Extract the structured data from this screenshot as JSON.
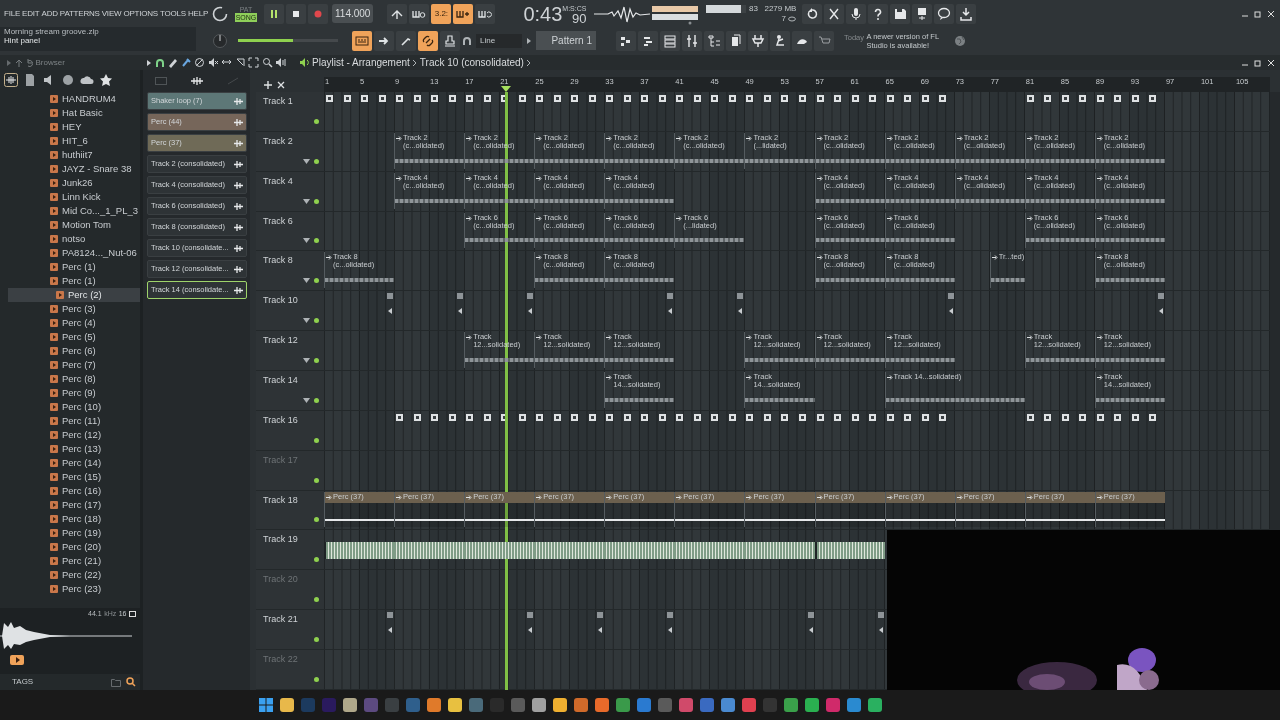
{
  "menu": [
    "FILE",
    "EDIT",
    "ADD",
    "PATTERNS",
    "VIEW",
    "OPTIONS",
    "TOOLS",
    "HELP"
  ],
  "hint": {
    "title": "Morning stream groove.zip",
    "text": "Hint panel"
  },
  "transport": {
    "pat": "PAT",
    "song": "SONG",
    "song_selected": true,
    "playing": true,
    "tempo": "114.000"
  },
  "toggles_row1": [
    {
      "on": false
    },
    {
      "on": false
    },
    {
      "on": true,
      "label": "3.2:"
    },
    {
      "on": true
    },
    {
      "on": false
    }
  ],
  "toggles_row2": [
    {
      "on": true
    },
    {
      "on": false
    },
    {
      "on": false
    },
    {
      "on": true
    },
    {
      "on": false
    }
  ],
  "clock": {
    "time": "0:43",
    "cs": "90",
    "format": "M:S:CS"
  },
  "stats": {
    "cpu": "83",
    "cpu_meter": {
      "level": 0.87
    },
    "memory": "2279 MB",
    "voices": "7"
  },
  "master_volume": {
    "level": 0.55
  },
  "snap": "Line",
  "pattern": "Pattern 1",
  "news": {
    "when": "Today",
    "text": "A newer version of FL Studio is available!"
  },
  "browser": {
    "title": "Browser",
    "items": [
      {
        "label": "HANDRUM4",
        "selected": false
      },
      {
        "label": "Hat Basic",
        "selected": false
      },
      {
        "label": "HEY",
        "selected": false
      },
      {
        "label": "HIT_6",
        "selected": false
      },
      {
        "label": "huthiit7",
        "selected": false
      },
      {
        "label": "JAYZ - Snare 38",
        "selected": false
      },
      {
        "label": "Junk26",
        "selected": false
      },
      {
        "label": "Linn Kick",
        "selected": false
      },
      {
        "label": "Mid Co..._1_PL_3",
        "selected": false
      },
      {
        "label": "Motion Tom",
        "selected": false
      },
      {
        "label": "notso",
        "selected": false
      },
      {
        "label": "PA8124..._Nut-06",
        "selected": false
      },
      {
        "label": "Perc (1)",
        "selected": false
      },
      {
        "label": "Perc (1)",
        "selected": false
      },
      {
        "label": "Perc (2)",
        "selected": true
      },
      {
        "label": "Perc (3)",
        "selected": false
      },
      {
        "label": "Perc (4)",
        "selected": false
      },
      {
        "label": "Perc (5)",
        "selected": false
      },
      {
        "label": "Perc (6)",
        "selected": false
      },
      {
        "label": "Perc (7)",
        "selected": false
      },
      {
        "label": "Perc (8)",
        "selected": false
      },
      {
        "label": "Perc (9)",
        "selected": false
      },
      {
        "label": "Perc (10)",
        "selected": false
      },
      {
        "label": "Perc (11)",
        "selected": false
      },
      {
        "label": "Perc (12)",
        "selected": false
      },
      {
        "label": "Perc (13)",
        "selected": false
      },
      {
        "label": "Perc (14)",
        "selected": false
      },
      {
        "label": "Perc (15)",
        "selected": false
      },
      {
        "label": "Perc (16)",
        "selected": false
      },
      {
        "label": "Perc (17)",
        "selected": false
      },
      {
        "label": "Perc (18)",
        "selected": false
      },
      {
        "label": "Perc (19)",
        "selected": false
      },
      {
        "label": "Perc (20)",
        "selected": false
      },
      {
        "label": "Perc (21)",
        "selected": false
      },
      {
        "label": "Perc (22)",
        "selected": false
      },
      {
        "label": "Perc (23)",
        "selected": false
      }
    ]
  },
  "preview": {
    "rate": "44.1",
    "unit": "kHz",
    "bits": "16",
    "tags": "TAGS"
  },
  "playlist": {
    "title": "Playlist - Arrangement",
    "crumb": "Track 10 (consolidated)",
    "clip_sources": [
      {
        "label": "Shaker loop (7)",
        "color": "#5d7777",
        "selected": false
      },
      {
        "label": "Perc (44)",
        "color": "#76665a",
        "selected": false
      },
      {
        "label": "Perc (37)",
        "color": "#6f6a57",
        "selected": false
      },
      {
        "label": "Track 2 (consolidated)",
        "color": "#2e3336",
        "selected": false
      },
      {
        "label": "Track 4 (consolidated)",
        "color": "#2e3336",
        "selected": false
      },
      {
        "label": "Track 6 (consolidated)",
        "color": "#2e3336",
        "selected": false
      },
      {
        "label": "Track 8 (consolidated)",
        "color": "#2e3336",
        "selected": false
      },
      {
        "label": "Track 10 (consolidate...",
        "color": "#2e3336",
        "selected": false
      },
      {
        "label": "Track 12 (consolidate...",
        "color": "#2e3336",
        "selected": false
      },
      {
        "label": "Track 14 (consolidate...",
        "color": "#2e3336",
        "selected": true
      }
    ],
    "ruler": [
      "1",
      "5",
      "9",
      "13",
      "17",
      "21",
      "25",
      "29",
      "33",
      "37",
      "41",
      "45",
      "49",
      "53",
      "57",
      "61",
      "65",
      "69",
      "73",
      "77",
      "81",
      "85",
      "89",
      "93",
      "97",
      "101",
      "105"
    ],
    "playhead": {
      "level": 0.191
    },
    "tracks": [
      {
        "name": "Track 1",
        "muted": false,
        "empty": false,
        "expander": false,
        "slots": [
          {
            "kind": "pattern"
          },
          {
            "kind": "pattern"
          },
          {
            "kind": "pattern"
          },
          {
            "kind": "pattern"
          },
          {
            "kind": "pattern"
          },
          {
            "kind": "pattern"
          },
          {
            "kind": "pattern"
          },
          {
            "kind": "pattern"
          },
          {
            "kind": "pattern"
          },
          {
            "kind": "gap"
          },
          {
            "kind": "pattern"
          },
          {
            "kind": "pattern"
          }
        ]
      },
      {
        "name": "Track 2",
        "muted": false,
        "empty": false,
        "expander": true,
        "slots": [
          {
            "kind": "gap"
          },
          {
            "kind": "audio",
            "label": "Track 2 (c...olidated)"
          },
          {
            "kind": "audio",
            "label": "Track 2 (c...olidated)"
          },
          {
            "kind": "audio",
            "label": "Track 2 (c...olidated)"
          },
          {
            "kind": "audio",
            "label": "Track 2 (c...olidated)"
          },
          {
            "kind": "audio",
            "label": "Track 2 (c...olidated)"
          },
          {
            "kind": "audio",
            "label": "Track 2 (...lidated)"
          },
          {
            "kind": "audio",
            "label": "Track 2 (c...olidated)"
          },
          {
            "kind": "audio",
            "label": "Track 2 (c...olidated)"
          },
          {
            "kind": "audio",
            "label": "Track 2 (c...olidated)"
          },
          {
            "kind": "audio",
            "label": "Track 2 (c...olidated)"
          },
          {
            "kind": "audio",
            "label": "Track 2 (c...olidated)"
          }
        ]
      },
      {
        "name": "Track 4",
        "muted": false,
        "empty": false,
        "expander": true,
        "slots": [
          {
            "kind": "gap"
          },
          {
            "kind": "audio",
            "label": "Track 4 (c...olidated)"
          },
          {
            "kind": "audio",
            "label": "Track 4 (c...olidated)"
          },
          {
            "kind": "audio",
            "label": "Track 4 (c...olidated)"
          },
          {
            "kind": "audio",
            "label": "Track 4 (c...olidated)"
          },
          {
            "kind": "gap"
          },
          {
            "kind": "gap"
          },
          {
            "kind": "audio",
            "label": "Track 4 (c...olidated)"
          },
          {
            "kind": "audio",
            "label": "Track 4 (c...olidated)"
          },
          {
            "kind": "audio",
            "label": "Track 4 (c...olidated)"
          },
          {
            "kind": "audio",
            "label": "Track 4 (c...olidated)"
          },
          {
            "kind": "audio",
            "label": "Track 4 (c...olidated)"
          }
        ]
      },
      {
        "name": "Track 6",
        "muted": false,
        "empty": false,
        "expander": true,
        "slots": [
          {
            "kind": "gap"
          },
          {
            "kind": "gap"
          },
          {
            "kind": "audio",
            "label": "Track 6 (c...olidated)"
          },
          {
            "kind": "audio",
            "label": "Track 6 (c...olidated)"
          },
          {
            "kind": "audio",
            "label": "Track 6 (c...olidated)"
          },
          {
            "kind": "audio",
            "label": "Track 6 (...lidated)"
          },
          {
            "kind": "gap"
          },
          {
            "kind": "audio",
            "label": "Track 6 (c...olidated)"
          },
          {
            "kind": "audio",
            "label": "Track 6 (c...olidated)"
          },
          {
            "kind": "gap"
          },
          {
            "kind": "audio",
            "label": "Track 6 (c...olidated)"
          },
          {
            "kind": "audio",
            "label": "Track 6 (c...olidated)"
          }
        ]
      },
      {
        "name": "Track 8",
        "muted": false,
        "empty": false,
        "expander": true,
        "slots": [
          {
            "kind": "audio",
            "label": "Track 8 (c...olidated)"
          },
          {
            "kind": "gap"
          },
          {
            "kind": "gap"
          },
          {
            "kind": "audio",
            "label": "Track 8 (c...olidated)"
          },
          {
            "kind": "audio",
            "label": "Track 8 (c...olidated)"
          },
          {
            "kind": "gap"
          },
          {
            "kind": "gap"
          },
          {
            "kind": "audio",
            "label": "Track 8 (c...olidated)"
          },
          {
            "kind": "audio",
            "label": "Track 8 (c...olidated)"
          },
          {
            "kind": "half",
            "label": "Tr...ted)"
          },
          {
            "kind": "gap"
          },
          {
            "kind": "audio",
            "label": "Track 8 (c...olidated)"
          }
        ]
      },
      {
        "name": "Track 10",
        "muted": false,
        "empty": false,
        "expander": true,
        "slots": [
          {
            "kind": "marker"
          },
          {
            "kind": "marker"
          },
          {
            "kind": "marker"
          },
          {
            "kind": "gap"
          },
          {
            "kind": "marker"
          },
          {
            "kind": "marker"
          },
          {
            "kind": "gap"
          },
          {
            "kind": "gap"
          },
          {
            "kind": "marker"
          },
          {
            "kind": "gap"
          },
          {
            "kind": "gap"
          },
          {
            "kind": "marker"
          }
        ]
      },
      {
        "name": "Track 12",
        "muted": false,
        "empty": false,
        "expander": true,
        "slots": [
          {
            "kind": "gap"
          },
          {
            "kind": "gap"
          },
          {
            "kind": "audio",
            "label": "Track 12...solidated)"
          },
          {
            "kind": "audio",
            "label": "Track 12...solidated)"
          },
          {
            "kind": "audio",
            "label": "Track 12...solidated)"
          },
          {
            "kind": "gap"
          },
          {
            "kind": "audio",
            "label": "Track 12...solidated)"
          },
          {
            "kind": "audio",
            "label": "Track 12...solidated)"
          },
          {
            "kind": "audio",
            "label": "Track 12...solidated)"
          },
          {
            "kind": "gap"
          },
          {
            "kind": "audio",
            "label": "Track 12...solidated)"
          },
          {
            "kind": "audio",
            "label": "Track 12...solidated)"
          }
        ]
      },
      {
        "name": "Track 14",
        "muted": false,
        "empty": false,
        "expander": true,
        "slots": [
          {
            "kind": "gap"
          },
          {
            "kind": "gap"
          },
          {
            "kind": "gap"
          },
          {
            "kind": "gap"
          },
          {
            "kind": "audio",
            "label": "Track 14...solidated)"
          },
          {
            "kind": "gap"
          },
          {
            "kind": "audio",
            "label": "Track 14...solidated)"
          },
          {
            "kind": "gap"
          },
          {
            "kind": "long",
            "label": "Track 14...solidated)"
          },
          {
            "kind": "gap"
          },
          {
            "kind": "gap"
          },
          {
            "kind": "audio",
            "label": "Track 14...solidated)"
          }
        ]
      },
      {
        "name": "Track 16",
        "muted": false,
        "empty": false,
        "expander": false,
        "slots": [
          {
            "kind": "gap"
          },
          {
            "kind": "pattern"
          },
          {
            "kind": "pattern"
          },
          {
            "kind": "pattern"
          },
          {
            "kind": "pattern"
          },
          {
            "kind": "pattern"
          },
          {
            "kind": "pattern"
          },
          {
            "kind": "pattern"
          },
          {
            "kind": "pattern"
          },
          {
            "kind": "gap"
          },
          {
            "kind": "pattern"
          },
          {
            "kind": "pattern"
          }
        ]
      },
      {
        "name": "Track 17",
        "muted": false,
        "empty": true,
        "expander": false
      },
      {
        "name": "Track 18",
        "muted": false,
        "empty": false,
        "expander": false,
        "slots": [
          {
            "kind": "audio",
            "label": "Perc (37)",
            "color": "#6c604e"
          },
          {
            "kind": "audio",
            "label": "Perc (37)",
            "color": "#6c604e"
          },
          {
            "kind": "audio",
            "label": "Perc (37)",
            "color": "#6c604e"
          },
          {
            "kind": "audio",
            "label": "Perc (37)",
            "color": "#6c604e"
          },
          {
            "kind": "audio",
            "label": "Perc (37)",
            "color": "#6c604e"
          },
          {
            "kind": "audio",
            "label": "Perc (37)",
            "color": "#6c604e"
          },
          {
            "kind": "audio",
            "label": "Perc (37)",
            "color": "#6c604e"
          },
          {
            "kind": "audio",
            "label": "Perc (37)",
            "color": "#6c604e"
          },
          {
            "kind": "audio",
            "label": "Perc (37)",
            "color": "#6c604e"
          },
          {
            "kind": "audio",
            "label": "Perc (37)",
            "color": "#6c604e"
          },
          {
            "kind": "audio",
            "label": "Perc (37)",
            "color": "#6c604e"
          },
          {
            "kind": "audio",
            "label": "Perc (37)",
            "color": "#6c604e"
          }
        ]
      },
      {
        "name": "Track 19",
        "muted": false,
        "empty": false,
        "expander": false,
        "slots": [
          {
            "kind": "wave",
            "color": "#7f9c86"
          },
          {
            "kind": "wave_more",
            "color": "#7f9c86"
          },
          {
            "kind": "wave_more",
            "color": "#7f9c86"
          },
          {
            "kind": "wave_more",
            "color": "#7f9c86"
          },
          {
            "kind": "wave_more",
            "color": "#7f9c86"
          },
          {
            "kind": "wave_more",
            "color": "#7f9c86"
          },
          {
            "kind": "wave_more",
            "color": "#7f9c86"
          },
          {
            "kind": "wave",
            "color": "#7f9c86"
          }
        ]
      },
      {
        "name": "Track 20",
        "muted": false,
        "empty": true,
        "expander": false
      },
      {
        "name": "Track 21",
        "muted": false,
        "empty": false,
        "expander": false,
        "slots": [
          {
            "kind": "marker"
          },
          {
            "kind": "gap"
          },
          {
            "kind": "marker"
          },
          {
            "kind": "marker"
          },
          {
            "kind": "marker"
          },
          {
            "kind": "gap"
          },
          {
            "kind": "marker"
          },
          {
            "kind": "marker"
          }
        ]
      },
      {
        "name": "Track 22",
        "muted": false,
        "empty": true,
        "expander": false
      }
    ]
  }
}
